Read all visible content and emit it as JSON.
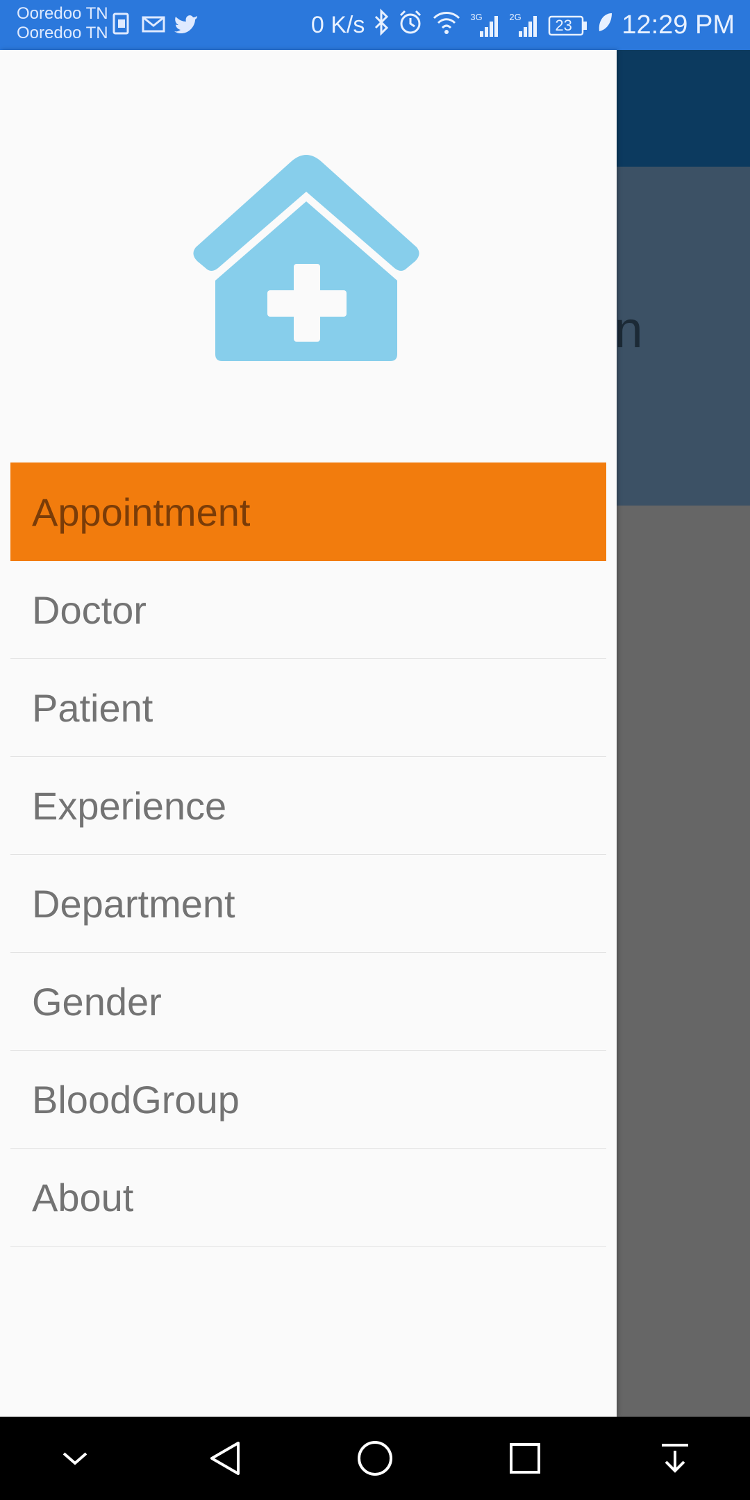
{
  "status_bar": {
    "carrier_1": "Ooredoo TN",
    "carrier_2": "Ooredoo TN",
    "speed": "0 K/s",
    "network_1": "3G",
    "network_2": "2G",
    "battery": "23",
    "time": "12:29 PM",
    "icons": [
      "sim-icon",
      "mail-icon",
      "twitter-icon",
      "bluetooth-icon",
      "alarm-icon",
      "wifi-icon",
      "signal-icon",
      "battery-icon",
      "leaf-icon"
    ]
  },
  "background": {
    "partial_text": "in"
  },
  "drawer": {
    "logo_icon": "hospital-house-icon",
    "logo_color": "#87ceeb",
    "active_color": "#f27c0d",
    "items": [
      {
        "label": "Appointment",
        "active": true
      },
      {
        "label": "Doctor",
        "active": false
      },
      {
        "label": "Patient",
        "active": false
      },
      {
        "label": "Experience",
        "active": false
      },
      {
        "label": "Department",
        "active": false
      },
      {
        "label": "Gender",
        "active": false
      },
      {
        "label": "BloodGroup",
        "active": false
      },
      {
        "label": "About",
        "active": false
      }
    ]
  },
  "nav_bar": {
    "buttons": [
      "collapse-icon",
      "back-icon",
      "home-icon",
      "recents-icon",
      "notification-pull-icon"
    ]
  }
}
